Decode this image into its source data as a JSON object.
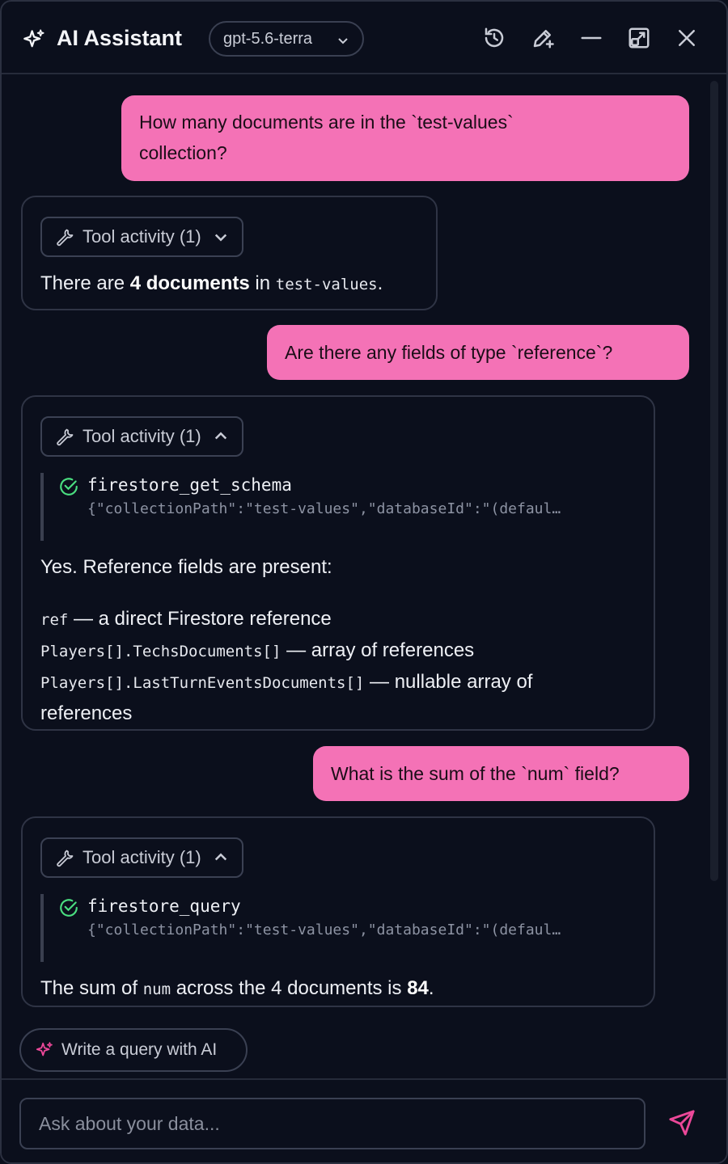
{
  "header": {
    "title": "AI Assistant",
    "model": "gpt-5.6-terra",
    "icons": [
      "sparkle-icon",
      "history-icon",
      "new-chat-icon",
      "minimize-icon",
      "popout-icon",
      "close-icon"
    ]
  },
  "messages": [
    {
      "role": "user",
      "text_a": "How many documents are in the `test-values`",
      "text_b": "collection?"
    },
    {
      "role": "assistant",
      "tool_label": "Tool activity (1)",
      "expanded": false,
      "parts": {
        "p1": "There are ",
        "bold": "4 documents",
        "p2": " in ",
        "code": "test-values",
        "p3": "."
      }
    },
    {
      "role": "user",
      "text": "Are there any fields of type `reference`?"
    },
    {
      "role": "assistant",
      "tool_label": "Tool activity (1)",
      "expanded": true,
      "tool_name": "firestore_get_schema",
      "tool_args": "{\"collectionPath\":\"test-values\",\"databaseId\":\"(defaul…",
      "intro": "Yes. Reference fields are present:",
      "fields": [
        {
          "code": "ref",
          "desc": " — a direct Firestore reference"
        },
        {
          "code": "Players[].TechsDocuments[]",
          "desc": " — array of references"
        },
        {
          "code": "Players[].LastTurnEventsDocuments[]",
          "desc": " — nullable array of"
        }
      ],
      "wrap": "references"
    },
    {
      "role": "user",
      "text": "What is the sum of the `num` field?"
    },
    {
      "role": "assistant",
      "tool_label": "Tool activity (1)",
      "expanded": true,
      "tool_name": "firestore_query",
      "tool_args": "{\"collectionPath\":\"test-values\",\"databaseId\":\"(defaul…",
      "parts": {
        "p1": "The sum of ",
        "code": "num",
        "p2": " across the 4 documents is ",
        "bold": "84",
        "p3": "."
      }
    }
  ],
  "suggestion": "Write a query with AI",
  "composer": {
    "placeholder": "Ask about your data..."
  },
  "colors": {
    "user_bubble": "#f472b6",
    "background": "#0b0f1c",
    "success": "#4ade80",
    "accent": "#ec4899"
  }
}
